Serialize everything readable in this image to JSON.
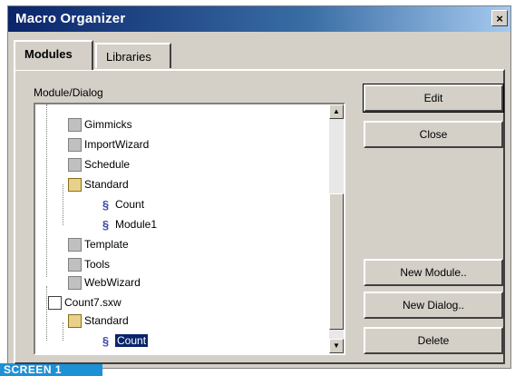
{
  "window": {
    "title": "Macro Organizer",
    "close_glyph": "×"
  },
  "tabs": [
    {
      "label": "Modules",
      "active": true
    },
    {
      "label": "Libraries",
      "active": false
    }
  ],
  "tree": {
    "label": "Module/Dialog",
    "items": [
      {
        "label": "Gimmicks",
        "icon": "library-icon",
        "level": 1
      },
      {
        "label": "ImportWizard",
        "icon": "library-icon",
        "level": 1
      },
      {
        "label": "Schedule",
        "icon": "library-icon",
        "level": 1
      },
      {
        "label": "Standard",
        "icon": "open-library-icon",
        "level": 1
      },
      {
        "label": "Count",
        "icon": "module-icon",
        "level": 2
      },
      {
        "label": "Module1",
        "icon": "module-icon",
        "level": 2
      },
      {
        "label": "Template",
        "icon": "library-icon",
        "level": 1
      },
      {
        "label": "Tools",
        "icon": "library-icon",
        "level": 1
      },
      {
        "label": "WebWizard",
        "icon": "library-icon",
        "level": 1
      },
      {
        "label": "Count7.sxw",
        "icon": "document-icon",
        "level": 0
      },
      {
        "label": "Standard",
        "icon": "open-library-icon",
        "level": 1
      },
      {
        "label": "Count",
        "icon": "module-icon",
        "level": 2,
        "selected": true
      }
    ]
  },
  "buttons": {
    "edit": "Edit",
    "close": "Close",
    "new_module": "New Module..",
    "new_dialog": "New Dialog..",
    "delete": "Delete"
  },
  "caption": "SCREEN 1"
}
